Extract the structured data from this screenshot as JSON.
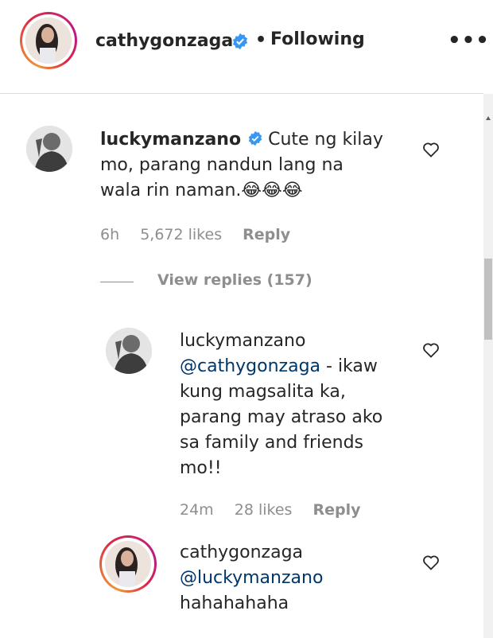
{
  "header": {
    "username": "cathygonzaga",
    "separator": "•",
    "follow_status": "Following",
    "more_label": "•••"
  },
  "comments": [
    {
      "username": "luckymanzano",
      "verified": true,
      "text_lines": [
        "Cute ng kilay",
        "mo, parang nandun lang na",
        "wala rin naman.😂😂😂"
      ],
      "time": "6h",
      "likes": "5,672 likes",
      "reply": "Reply"
    }
  ],
  "view_replies": "View replies (157)",
  "replies": [
    {
      "username": "luckymanzano",
      "mention": "@cathygonzaga",
      "text_lines": [
        " - ikaw",
        "kung magsalita ka,",
        "parang may atraso ako",
        "sa family and friends",
        "mo!!"
      ],
      "time": "24m",
      "likes": "28 likes",
      "reply": "Reply"
    },
    {
      "username": "cathygonzaga",
      "mention": "@luckymanzano",
      "text_lines": [
        "hahahahaha"
      ]
    }
  ],
  "colors": {
    "text": "#262626",
    "secondary": "#8e8e8e",
    "mention": "#00376b",
    "verified": "#3897f0"
  }
}
